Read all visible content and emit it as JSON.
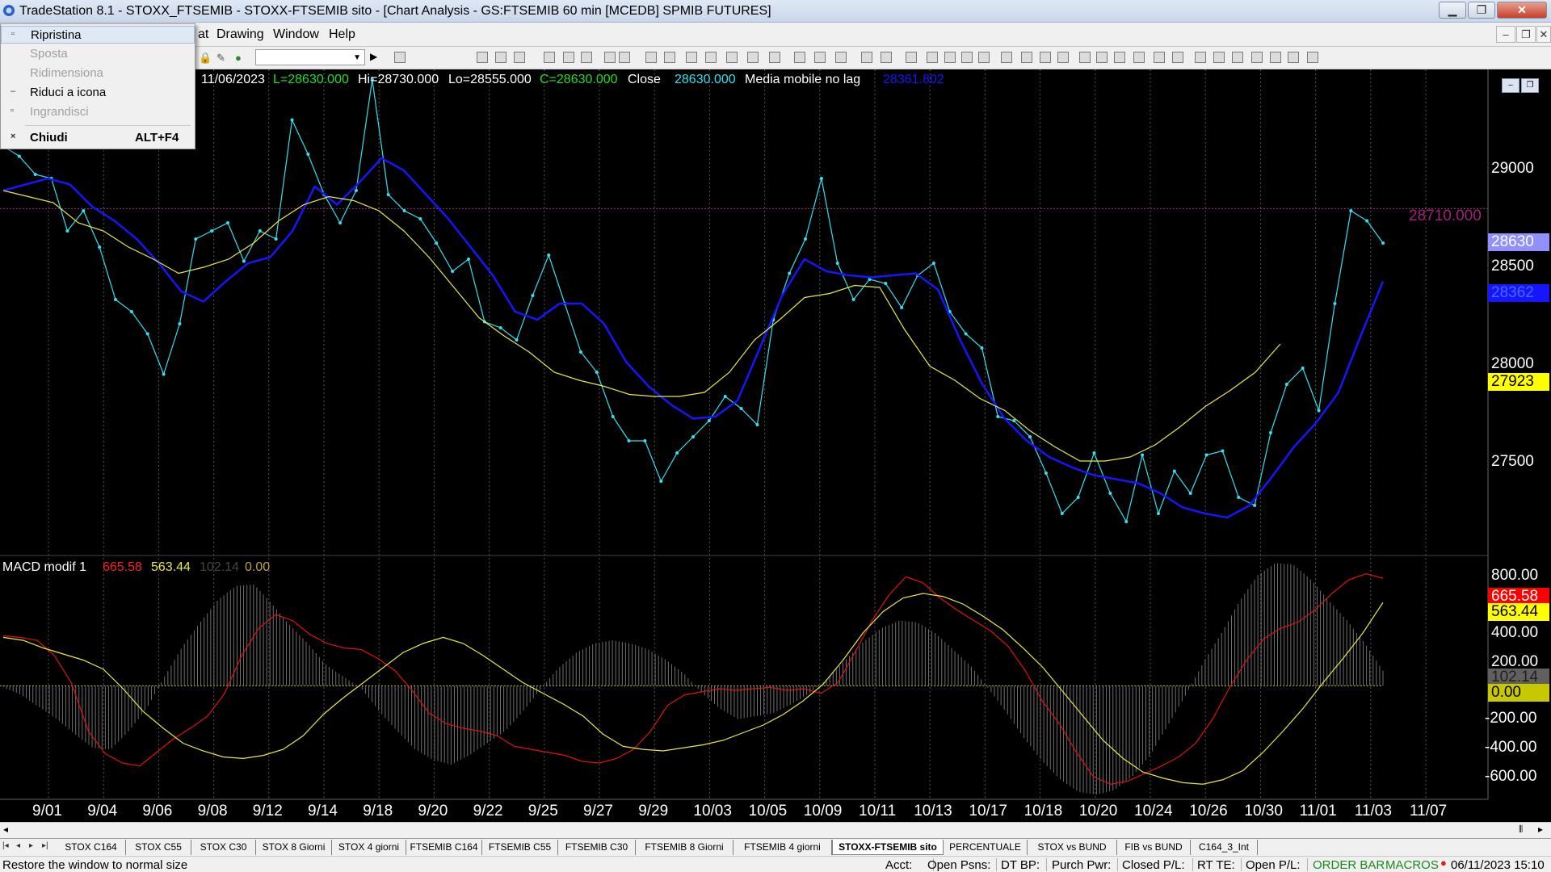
{
  "window": {
    "title": "TradeStation 8.1 - STOXX_FTSEMIB - STOXX-FTSEMIB sito - [Chart Analysis - GS:FTSEMIB  60 min  [MCEDB] SPMIB FUTURES]",
    "minimize_symbol": "▁",
    "maximize_symbol": "❐",
    "close_symbol": "✕"
  },
  "menubar": {
    "items": [
      "at",
      "Drawing",
      "Window",
      "Help"
    ]
  },
  "sysmenu": {
    "items": [
      {
        "icon": "▫",
        "label": "Ripristina",
        "accel": "",
        "disabled": false
      },
      {
        "icon": "",
        "label": "Sposta",
        "accel": "",
        "disabled": true
      },
      {
        "icon": "",
        "label": "Ridimensiona",
        "accel": "",
        "disabled": true
      },
      {
        "icon": "–",
        "label": "Riduci a icona",
        "accel": "",
        "disabled": false
      },
      {
        "icon": "▫",
        "label": "Ingrandisci",
        "accel": "",
        "disabled": true
      },
      {
        "icon": "×",
        "label": "Chiudi",
        "accel": "ALT+F4",
        "disabled": false
      }
    ]
  },
  "chart_header": {
    "date": "11/06/2023",
    "low_label": "L=28630.000",
    "high_label": "Hi=28730.000",
    "lo_label": "Lo=28555.000",
    "close_label": "C=28630.000",
    "close_text": "Close",
    "close_value": "28630.000",
    "indicator_name": "Media mobile no lag",
    "indicator_value": "28361.802"
  },
  "macd_header": {
    "name": "MACD modif 1",
    "v1": "665.58",
    "v2": "563.44",
    "v3": "102.14",
    "v4": "0.00"
  },
  "price_axis": {
    "labels": [
      "29000",
      "28500",
      "28000",
      "27500"
    ],
    "ref_line_label": "28710.000",
    "boxes": {
      "last": "28630",
      "blue": "28362",
      "yellow": "27923"
    }
  },
  "macd_axis": {
    "labels": [
      "800.00",
      "400.00",
      "200.00",
      "-200.00",
      "-400.00",
      "-600.00"
    ],
    "boxes": {
      "red": "665.58",
      "yellow": "563.44",
      "gray": "102.14",
      "zero": "0.00"
    }
  },
  "colors": {
    "price": "#33e0f0",
    "nolag": "#1515ff",
    "ma": "#e8e84a",
    "macd": "#e01010",
    "signal": "#e8e84a",
    "hist": "#707070",
    "ref": "#a0207a"
  },
  "chart_data": [
    {
      "type": "line",
      "title": "",
      "x_tick_labels": [
        "9/01",
        "9/04",
        "9/06",
        "9/08",
        "9/12",
        "9/14",
        "9/18",
        "9/20",
        "9/22",
        "9/25",
        "9/27",
        "9/29",
        "10/03",
        "10/05",
        "10/09",
        "10/11",
        "10/13",
        "10/17",
        "10/18",
        "10/20",
        "10/24",
        "10/26",
        "10/30",
        "11/01",
        "11/03",
        "11/07"
      ],
      "ylim": [
        27000,
        29400
      ],
      "y_ticks": [
        27500,
        28000,
        28500,
        29000
      ],
      "reference_line": 28710,
      "series": [
        {
          "values": [
            29020,
            28970,
            28880,
            28860,
            28600,
            28700,
            28520,
            28260,
            28200,
            28090,
            27890,
            28140,
            28560,
            28600,
            28640,
            28450,
            28600,
            28560,
            29150,
            28980,
            28780,
            28640,
            28800,
            29350,
            28780,
            28700,
            28660,
            28540,
            28400,
            28460,
            28150,
            28120,
            28060,
            28280,
            28480,
            28240,
            28000,
            27900,
            27680,
            27560,
            27560,
            27360,
            27500,
            27580,
            27660,
            27780,
            27720,
            27640,
            28160,
            28390,
            28560,
            28860,
            28440,
            28260,
            28360,
            28340,
            28220,
            28380,
            28440,
            28200,
            28090,
            28020,
            27680,
            27660,
            27580,
            27400,
            27200,
            27280,
            27500,
            27300,
            27160,
            27490,
            27200,
            27410,
            27300,
            27490,
            27510,
            27280,
            27240,
            27600,
            27840,
            27920,
            27710,
            28240,
            28700,
            28650,
            28540
          ]
        },
        {
          "values": [
            28800,
            28830,
            28860,
            28830,
            28720,
            28650,
            28560,
            28440,
            28300,
            28250,
            28350,
            28440,
            28470,
            28600,
            28820,
            28730,
            28840,
            28960,
            28900,
            28780,
            28660,
            28520,
            28380,
            28200,
            28160,
            28240,
            28240,
            28140,
            27950,
            27830,
            27740,
            27670,
            27680,
            27760,
            28020,
            28280,
            28460,
            28400,
            28380,
            28370,
            28380,
            28390,
            28310,
            28060,
            27840,
            27670,
            27560,
            27480,
            27430,
            27390,
            27370,
            27350,
            27300,
            27230,
            27200,
            27180,
            27240,
            27380,
            27530,
            27650,
            27800,
            28080,
            28350
          ]
        },
        {
          "values": [
            28800,
            28770,
            28740,
            28640,
            28600,
            28520,
            28460,
            28390,
            28420,
            28460,
            28540,
            28650,
            28730,
            28770,
            28750,
            28700,
            28600,
            28470,
            28320,
            28170,
            28080,
            28000,
            27900,
            27860,
            27830,
            27790,
            27780,
            27780,
            27800,
            27900,
            28060,
            28160,
            28270,
            28290,
            28330,
            28320,
            28110,
            27930,
            27860,
            27770,
            27710,
            27610,
            27530,
            27460,
            27460,
            27480,
            27540,
            27630,
            27730,
            27810,
            27900,
            28040
          ]
        }
      ]
    },
    {
      "type": "line",
      "title": "",
      "ylim": [
        -750,
        850
      ],
      "y_ticks": [
        800,
        400,
        200,
        -200,
        -400,
        -600
      ],
      "series": [
        {
          "values": [
            330,
            320,
            300,
            200,
            20,
            -300,
            -450,
            -510,
            -530,
            -440,
            -350,
            -280,
            -200,
            -50,
            200,
            380,
            470,
            430,
            340,
            280,
            250,
            240,
            180,
            100,
            -30,
            -180,
            -250,
            -280,
            -300,
            -330,
            -400,
            -420,
            -440,
            -460,
            -500,
            -510,
            -480,
            -420,
            -300,
            -130,
            -60,
            -40,
            -20,
            -30,
            -20,
            -10,
            -30,
            -20,
            -50,
            20,
            220,
            430,
            600,
            720,
            680,
            580,
            500,
            430,
            360,
            260,
            100,
            -100,
            -250,
            -440,
            -600,
            -650,
            -630,
            -580,
            -530,
            -470,
            -380,
            -220,
            -10,
            170,
            310,
            380,
            420,
            500,
            610,
            700,
            740,
            710
          ]
        },
        {
          "values": [
            320,
            300,
            250,
            210,
            170,
            110,
            -20,
            -170,
            -280,
            -380,
            -430,
            -470,
            -480,
            -460,
            -420,
            -330,
            -190,
            -80,
            20,
            120,
            220,
            280,
            320,
            280,
            200,
            110,
            20,
            -50,
            -120,
            -200,
            -320,
            -400,
            -420,
            -430,
            -410,
            -390,
            -360,
            -310,
            -260,
            -190,
            -100,
            10,
            170,
            350,
            490,
            580,
            610,
            590,
            540,
            460,
            370,
            250,
            120,
            -40,
            -200,
            -360,
            -480,
            -570,
            -610,
            -640,
            -650,
            -620,
            -560,
            -440,
            -300,
            -150,
            20,
            180,
            350,
            550
          ]
        },
        {
          "values": [
            -10,
            -60,
            -140,
            -220,
            -320,
            -410,
            -420,
            -300,
            -150,
            60,
            260,
            420,
            570,
            660,
            670,
            540,
            400,
            280,
            140,
            60,
            -20,
            -170,
            -300,
            -420,
            -490,
            -520,
            -460,
            -380,
            -300,
            -170,
            -20,
            120,
            220,
            280,
            300,
            280,
            240,
            170,
            80,
            -50,
            -150,
            -220,
            -200,
            -180,
            -120,
            -50,
            50,
            170,
            290,
            380,
            430,
            420,
            350,
            240,
            130,
            -20,
            -180,
            -350,
            -500,
            -620,
            -700,
            -720,
            -690,
            -600,
            -460,
            -260,
            -60,
            160,
            350,
            560,
            730,
            810,
            800,
            700,
            560,
            430,
            280,
            100
          ]
        }
      ]
    }
  ],
  "tabs": {
    "items": [
      "STOX C164",
      "STOX C55",
      "STOX  C30",
      "STOX  8 Giorni",
      "STOX 4 giorni",
      "FTSEMIB C164",
      "FTSEMIB C55",
      "FTSEMIB C30",
      "FTSEMIB  8 Giorni",
      "FTSEMIB  4 giorni",
      "STOXX-FTSEMIB sito",
      "PERCENTUALE",
      "STOX vs BUND",
      "FIB vs BUND",
      "C164_3_Int"
    ],
    "active": 10
  },
  "statusbar": {
    "hint": "Restore the window to normal size",
    "acct": "Acct:",
    "open_psns": "Open Psns:",
    "dt_bp": "DT BP:",
    "purch_pwr": "Purch Pwr:",
    "closed_pl": "Closed P/L:",
    "rt_te": "RT TE:",
    "open_pl": "Open P/L:",
    "order_bar": "ORDER BAR",
    "macros": "MACROS",
    "datetime": "06/11/2023 15:10"
  }
}
